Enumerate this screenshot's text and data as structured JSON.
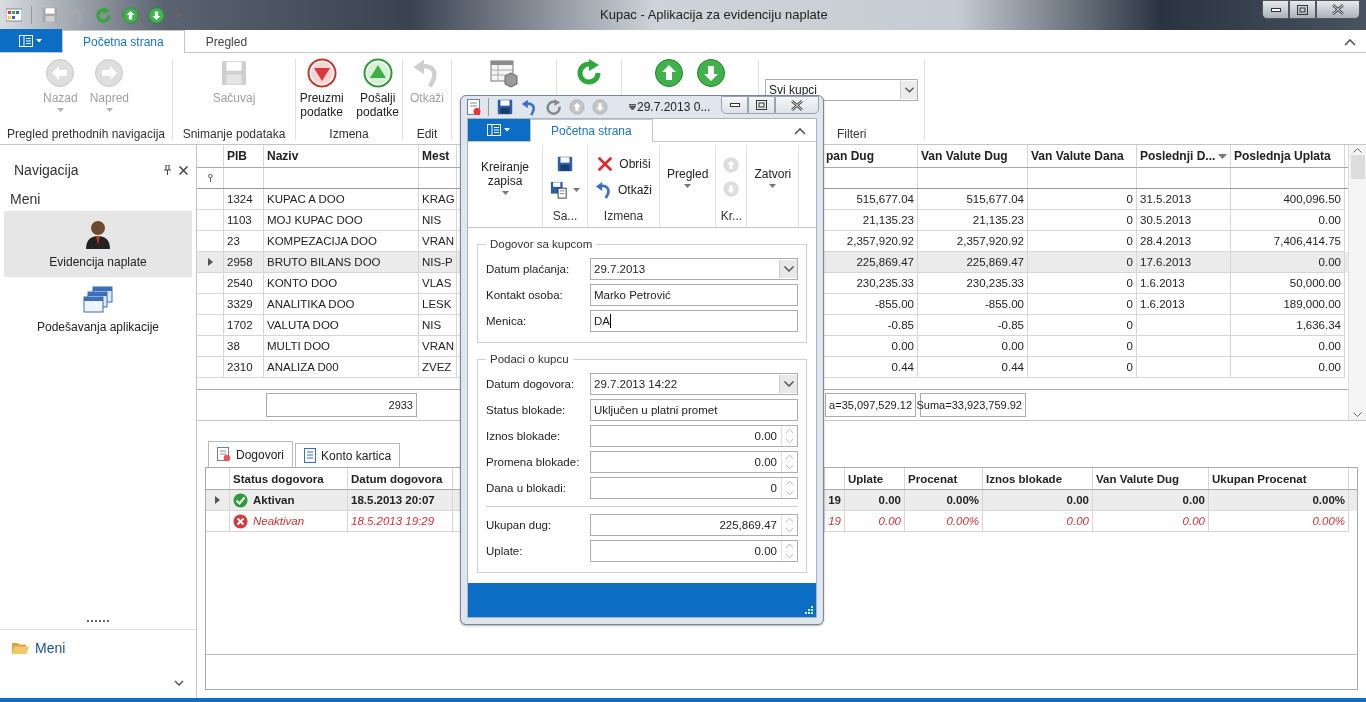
{
  "window": {
    "title": "Kupac - Aplikacija za evidenciju naplate"
  },
  "ribbon": {
    "tabs": [
      {
        "label": "Početna strana",
        "selected": true
      },
      {
        "label": "Pregled",
        "selected": false
      }
    ],
    "groups": [
      {
        "label": "Pregled prethodnih navigacija",
        "buttons": [
          {
            "kind": "back",
            "label": "Nazad",
            "disabled": true,
            "dropdown": true
          },
          {
            "kind": "forward",
            "label": "Napred",
            "disabled": true,
            "dropdown": true
          }
        ]
      },
      {
        "label": "Snimanje podataka",
        "buttons": [
          {
            "kind": "save",
            "label": "Sačuvaj",
            "disabled": true
          }
        ]
      },
      {
        "label": "Izmena",
        "buttons": [
          {
            "kind": "download",
            "label": "Preuzmi podatke",
            "disabled": false
          },
          {
            "kind": "upload",
            "label": "Pošalji podatke",
            "disabled": false
          }
        ]
      },
      {
        "label": "Edit",
        "buttons": [
          {
            "kind": "undo",
            "label": "Otkaži",
            "disabled": true
          }
        ]
      },
      {
        "buttons": [
          {
            "kind": "table",
            "disabled": false
          }
        ]
      },
      {
        "buttons": [
          {
            "kind": "refresh",
            "disabled": false
          }
        ]
      },
      {
        "buttons": [
          {
            "kind": "up",
            "disabled": false
          },
          {
            "kind": "down",
            "disabled": false
          }
        ]
      },
      {
        "label": "Filteri",
        "combo": {
          "value": "Svi kupci"
        }
      }
    ]
  },
  "navigation": {
    "title": "Navigacija",
    "section": "Meni",
    "items": [
      {
        "label": "Evidencija naplate",
        "kind": "person",
        "selected": true
      },
      {
        "label": "Podešavanja aplikacije",
        "kind": "windows",
        "selected": false
      }
    ],
    "footer": "Meni"
  },
  "grid": {
    "columns": [
      {
        "label": "PIB",
        "sorted": false
      },
      {
        "label": "Naziv",
        "sorted": false
      },
      {
        "label": "Mest",
        "sorted": false
      },
      {
        "label": "pan Dug",
        "sorted": false
      },
      {
        "label": "Van Valute Dug",
        "sorted": false
      },
      {
        "label": "Van Valute Dana",
        "sorted": false
      },
      {
        "label": "Poslednji D...",
        "sorted": true
      },
      {
        "label": "Poslednja Uplata",
        "sorted": false
      }
    ],
    "rows": [
      {
        "selected": false,
        "pib": "1324",
        "naziv": "KUPAC A DOO",
        "mest": "KRAG",
        "pan_dug": "515,677.04",
        "van_valute_dug": "515,677.04",
        "van_valute_dana": "0",
        "poslednji_d": "31.5.2013",
        "poslednja_uplata": "400,096.50"
      },
      {
        "selected": false,
        "pib": "1103",
        "naziv": "MOJ KUPAC DOO",
        "mest": "NIS",
        "pan_dug": "21,135.23",
        "van_valute_dug": "21,135.23",
        "van_valute_dana": "0",
        "poslednji_d": "30.5.2013",
        "poslednja_uplata": "0.00"
      },
      {
        "selected": false,
        "pib": "23",
        "naziv": "KOMPEZACIJA DOO",
        "mest": "VRAN",
        "pan_dug": "2,357,920.92",
        "van_valute_dug": "2,357,920.92",
        "van_valute_dana": "0",
        "poslednji_d": "28.4.2013",
        "poslednja_uplata": "7,406,414.75"
      },
      {
        "selected": true,
        "pib": "2958",
        "naziv": "BRUTO BILANS DOO",
        "mest": "NIS-P",
        "pan_dug": "225,869.47",
        "van_valute_dug": "225,869.47",
        "van_valute_dana": "0",
        "poslednji_d": "17.6.2013",
        "poslednja_uplata": "0.00"
      },
      {
        "selected": false,
        "pib": "2540",
        "naziv": "KONTO DOO",
        "mest": "VLAS",
        "pan_dug": "230,235.33",
        "van_valute_dug": "230,235.33",
        "van_valute_dana": "0",
        "poslednji_d": "1.6.2013",
        "poslednja_uplata": "50,000.00"
      },
      {
        "selected": false,
        "pib": "3329",
        "naziv": "ANALITIKA DOO",
        "mest": "LESK",
        "pan_dug": "-855.00",
        "van_valute_dug": "-855.00",
        "van_valute_dana": "0",
        "poslednji_d": "1.6.2013",
        "poslednja_uplata": "189,000.00"
      },
      {
        "selected": false,
        "pib": "1702",
        "naziv": "VALUTA DOO",
        "mest": "NIS",
        "pan_dug": "-0.85",
        "van_valute_dug": "-0.85",
        "van_valute_dana": "0",
        "poslednja_uplata": "1,636.34"
      },
      {
        "selected": false,
        "pib": "38",
        "naziv": "MULTI DOO",
        "mest": "VRAN",
        "pan_dug": "0.00",
        "van_valute_dug": "0.00",
        "van_valute_dana": "0",
        "poslednja_uplata": "0.00"
      },
      {
        "selected": false,
        "pib": "2310",
        "naziv": "ANALIZA D00",
        "mest": "ZVEZ",
        "pan_dug": "0.44",
        "van_valute_dug": "0.44",
        "van_valute_dana": "0",
        "poslednja_uplata": "0.00"
      }
    ],
    "footer": {
      "naziv": "2933",
      "pan_dug": "a=35,097,529.12",
      "van_valute_dug": "Suma=33,923,759.92"
    }
  },
  "contracts": {
    "tabs": [
      {
        "label": "Dogovori",
        "kind": "contract",
        "selected": true
      },
      {
        "label": "Konto kartica",
        "kind": "sheet",
        "selected": false
      }
    ],
    "columns": {
      "status": "Status dogovora",
      "datum": "Datum dogovora",
      "uplate": "Uplate",
      "procenat": "Procenat",
      "iznos_blokade": "Iznos blokade",
      "van_valute_dug": "Van Valute Dug",
      "ukupan_procenat": "Ukupan Procenat"
    },
    "rows": [
      {
        "kind": "active",
        "selected": true,
        "status": "Aktivan",
        "datum": "18.5.2013 20:07",
        "column_3": "19",
        "uplate": "0.00",
        "procenat": "0.00%",
        "iznos_blokade": "0.00",
        "van_valute_dug": "0.00",
        "ukupan_procenat": "0.00%"
      },
      {
        "kind": "inactive",
        "selected": false,
        "status": "Neaktivan",
        "datum": "18.5.2013 19:29",
        "column_3": "19",
        "uplate": "0.00",
        "procenat": "0.00%",
        "iznos_blokade": "0.00",
        "van_valute_dug": "0.00",
        "ukupan_procenat": "0.00%"
      }
    ]
  },
  "dialog": {
    "title": "29.7.2013 0...",
    "tabs": [
      {
        "label": "Početna strana",
        "selected": true
      }
    ],
    "groups": [
      {
        "items": [
          {
            "kind": "text",
            "label": "Kreiranje zapisa",
            "dropdown": true
          }
        ]
      },
      {
        "label": "Sa...",
        "items": [
          {
            "kind": "save",
            "disabled": false
          },
          {
            "kind": "save-as",
            "disabled": false,
            "dropdown": true
          }
        ]
      },
      {
        "label": "Izmena",
        "items": [
          {
            "kind": "delete",
            "label": "Obriši",
            "disabled": false
          },
          {
            "kind": "undo",
            "label": "Otkaži",
            "disabled": false
          }
        ]
      },
      {
        "items": [
          {
            "kind": "text",
            "label": "Pregled",
            "dropdown": true
          }
        ]
      },
      {
        "label": "Kr...",
        "items": [
          {
            "kind": "up",
            "disabled": true
          },
          {
            "kind": "down",
            "disabled": true
          }
        ]
      },
      {
        "items": [
          {
            "kind": "text",
            "label": "Zatvori",
            "dropdown": true
          }
        ]
      }
    ],
    "sections": [
      {
        "legend": "Dogovor sa kupcom",
        "fields": [
          {
            "label": "Datum plaćanja:",
            "kind": "date",
            "value": "29.7.2013"
          },
          {
            "label": "Kontakt osoba:",
            "kind": "text",
            "value": "Marko Petrović"
          },
          {
            "label": "Menica:",
            "kind": "text",
            "value": "DA",
            "focused": true
          }
        ]
      },
      {
        "legend": "Podaci o kupcu",
        "fields": [
          {
            "label": "Datum dogovora:",
            "kind": "date",
            "value": "29.7.2013 14:22"
          },
          {
            "label": "Status blokade:",
            "kind": "text",
            "value": "Uključen u platni promet"
          },
          {
            "label": "Iznos blokade:",
            "kind": "number",
            "value": "0.00"
          },
          {
            "label": "Promena blokade:",
            "kind": "number",
            "value": "0.00"
          },
          {
            "label": "Dana u blokadi:",
            "kind": "number",
            "value": "0"
          }
        ],
        "totals": [
          {
            "label": "Ukupan dug:",
            "kind": "number",
            "value": "225,869.47"
          },
          {
            "label": "Uplate:",
            "kind": "number",
            "value": "0.00"
          }
        ]
      }
    ]
  }
}
